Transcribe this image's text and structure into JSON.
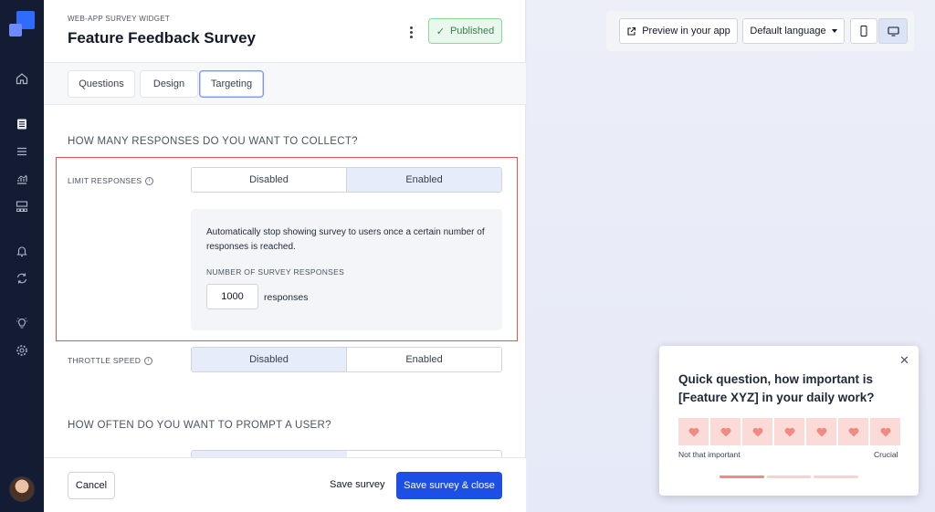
{
  "header": {
    "eyebrow": "WEB-APP SURVEY WIDGET",
    "title": "Feature Feedback Survey",
    "status": "Published"
  },
  "tabs": [
    "Questions",
    "Design",
    "Targeting"
  ],
  "active_tab": "Targeting",
  "sections": {
    "responses_heading": "HOW MANY RESPONSES DO YOU WANT TO COLLECT?",
    "prompt_heading": "HOW OFTEN DO YOU WANT TO PROMPT A USER?"
  },
  "limit_responses": {
    "label": "LIMIT RESPONSES",
    "options": [
      "Disabled",
      "Enabled"
    ],
    "selected": "Enabled",
    "description": "Automatically stop showing survey to users once a certain number of responses is reached.",
    "count_label": "NUMBER OF SURVEY RESPONSES",
    "count_value": "1000",
    "count_unit": "responses"
  },
  "throttle_speed": {
    "label": "THROTTLE SPEED",
    "options": [
      "Disabled",
      "Enabled"
    ],
    "selected": "Disabled"
  },
  "footer": {
    "cancel": "Cancel",
    "save": "Save survey",
    "save_close": "Save survey & close"
  },
  "preview_toolbar": {
    "preview_label": "Preview in your app",
    "language_label": "Default language"
  },
  "widget": {
    "question": "Quick question, how important is [Feature XYZ] in your daily work?",
    "scale_count": 7,
    "low_label": "Not that important",
    "high_label": "Crucial",
    "progress_steps": 3,
    "progress_current": 1
  },
  "colors": {
    "sidebar": "#141c33",
    "primary": "#1d4fe6",
    "published_bg": "#e8f8ec",
    "highlight_border": "#e2574c",
    "heart": "#f08a82"
  }
}
